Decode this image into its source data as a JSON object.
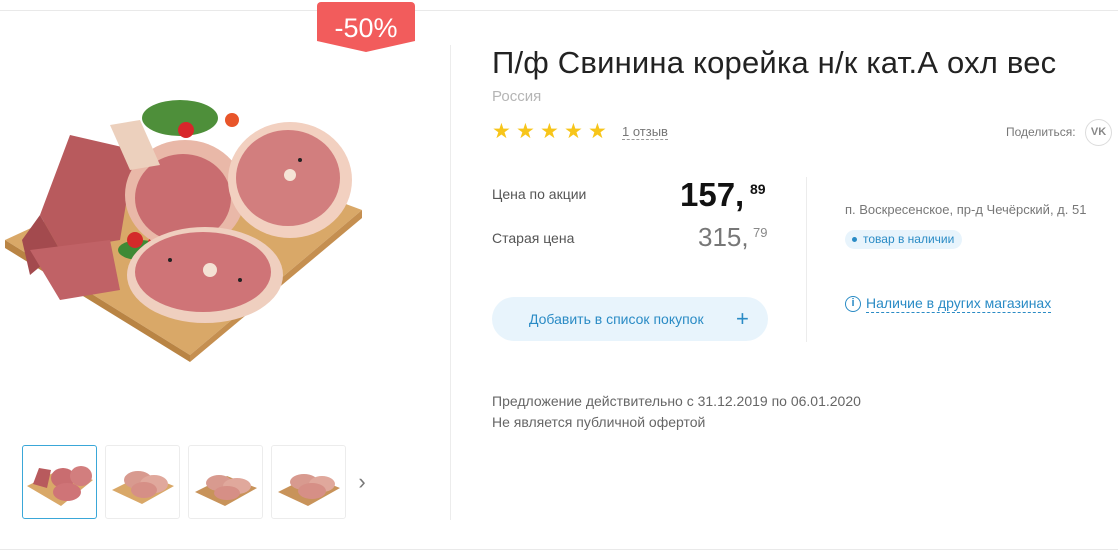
{
  "badge": {
    "discount": "-50%"
  },
  "product": {
    "title": "П/ф Свинина корейка н/к кат.А охл вес",
    "country": "Россия",
    "rating_stars": 5,
    "reviews_link": "1 отзыв"
  },
  "share": {
    "label": "Поделиться:",
    "vk_label": "VK"
  },
  "pricing": {
    "promo_label": "Цена по акции",
    "promo_price": "157,",
    "promo_cents": "89",
    "old_label": "Старая цена",
    "old_price": "315,",
    "old_cents": "79"
  },
  "actions": {
    "add_to_list": "Добавить в список покупок",
    "add_icon": "+"
  },
  "store": {
    "address": "п. Воскресенское, пр-д Чечёрский, д. 51",
    "stock_status": "товар в наличии",
    "other_stores": "Наличие в других магазинах"
  },
  "offer": {
    "validity": "Предложение действительно с 31.12.2019 по 06.01.2020",
    "note": "Не является публичной офертой"
  },
  "gallery": {
    "next_icon": "›"
  },
  "colors": {
    "accent": "#2a8bc5",
    "badge": "#f25c5c",
    "star": "#f7c51a"
  }
}
